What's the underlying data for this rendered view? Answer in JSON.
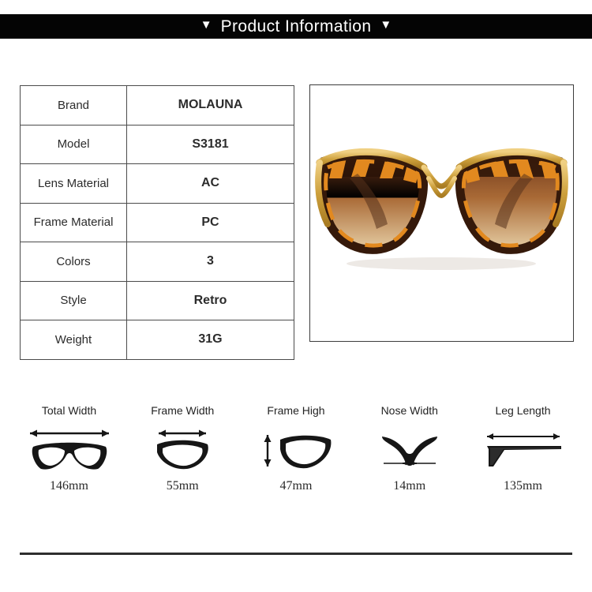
{
  "header": {
    "title": "Product Information",
    "left_marker": "▼",
    "right_marker": "▼",
    "background_color": "#040404",
    "text_color": "#ffffff"
  },
  "spec_table": {
    "rows": [
      {
        "key": "Brand",
        "value": "MOLAUNA"
      },
      {
        "key": "Model",
        "value": "S3181"
      },
      {
        "key": "Lens Material",
        "value": "AC"
      },
      {
        "key": "Frame Material",
        "value": "PC"
      },
      {
        "key": "Colors",
        "value": "3"
      },
      {
        "key": "Style",
        "value": "Retro"
      },
      {
        "key": "Weight",
        "value": "31G"
      }
    ]
  },
  "product_photo": {
    "alt": "cat-eye sunglasses with tortoiseshell frame and gradient brown lenses",
    "frame_gold": "#d8a93f",
    "tortoise_light": "#e08a22",
    "tortoise_dark": "#2e1508",
    "lens_top": "#6b3418",
    "lens_bottom": "#e3c79a"
  },
  "measurements": [
    {
      "label": "Total Width",
      "value": "146mm",
      "icon": "full-frame-icon"
    },
    {
      "label": "Frame Width",
      "value": "55mm",
      "icon": "single-lens-width-icon"
    },
    {
      "label": "Frame High",
      "value": "47mm",
      "icon": "single-lens-height-icon"
    },
    {
      "label": "Nose Width",
      "value": "14mm",
      "icon": "nose-bridge-icon"
    },
    {
      "label": "Leg Length",
      "value": "135mm",
      "icon": "temple-arm-icon"
    }
  ]
}
